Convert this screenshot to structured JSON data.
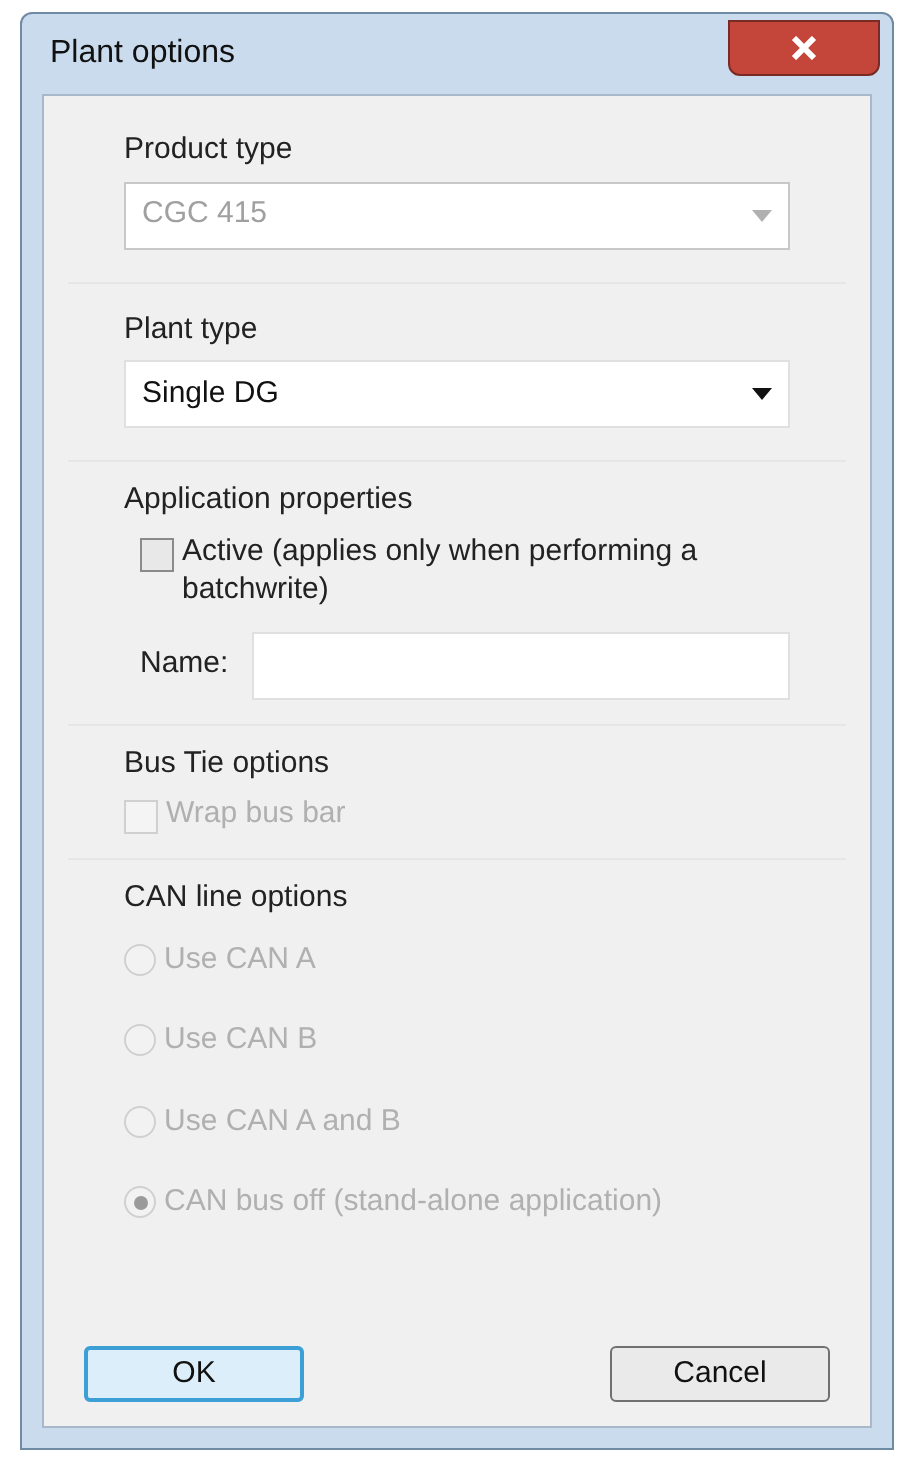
{
  "window": {
    "title": "Plant options"
  },
  "product_type": {
    "label": "Product type",
    "value": "CGC 415",
    "disabled": true
  },
  "plant_type": {
    "label": "Plant type",
    "value": "Single DG",
    "disabled": false
  },
  "application": {
    "label": "Application properties",
    "active": {
      "label": "Active (applies only when performing a batchwrite)",
      "checked": false,
      "disabled": false
    },
    "name_label": "Name:"
  },
  "bus_tie": {
    "label": "Bus Tie options",
    "wrap": {
      "label": "Wrap bus bar",
      "checked": false,
      "disabled": true
    }
  },
  "can": {
    "label": "CAN line options",
    "options": [
      {
        "label": "Use CAN A",
        "selected": false,
        "disabled": true
      },
      {
        "label": "Use CAN B",
        "selected": false,
        "disabled": true
      },
      {
        "label": "Use CAN A and B",
        "selected": false,
        "disabled": true
      },
      {
        "label": "CAN bus off (stand-alone application)",
        "selected": true,
        "disabled": true
      }
    ]
  },
  "buttons": [
    {
      "label": "OK",
      "default": true
    },
    {
      "label": "Cancel",
      "default": false
    }
  ]
}
